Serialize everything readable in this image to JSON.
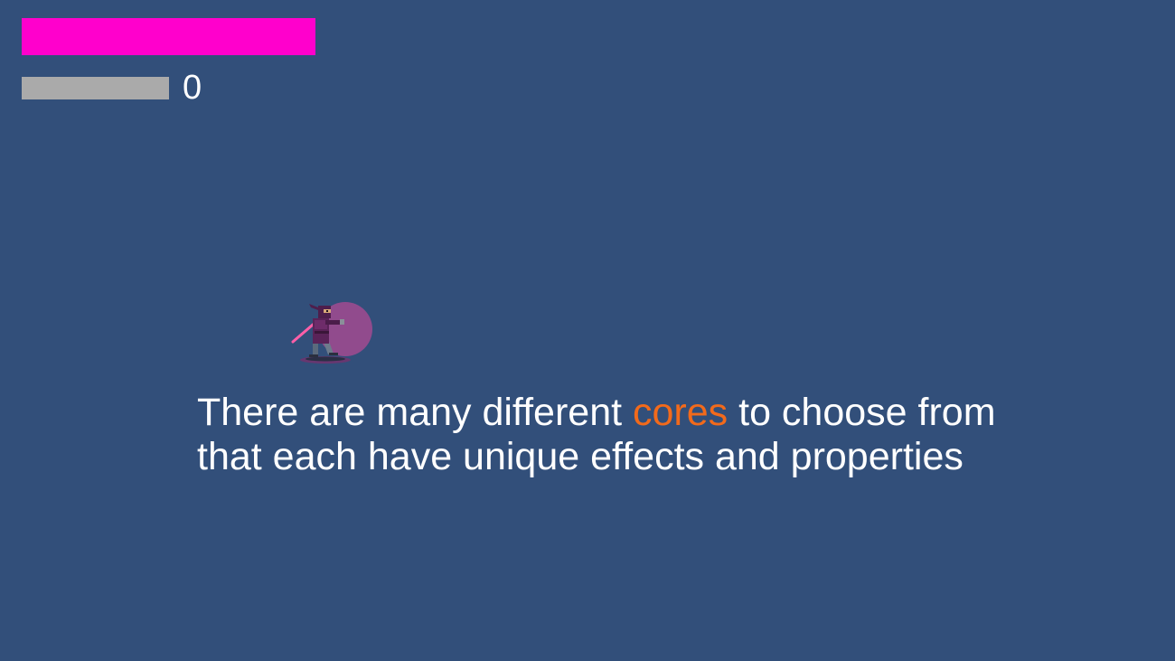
{
  "hud": {
    "health_bar": {
      "fill_fraction": 1.0,
      "color": "#ff00cc"
    },
    "xp_bar": {
      "fill_fraction": 1.0,
      "color": "#aaaaaa"
    },
    "counter": "0"
  },
  "player": {
    "sprite": "ninja-icon",
    "aura_color": "#9b4a8f",
    "weapon_color": "#ff5fa8"
  },
  "tutorial": {
    "line1_before": "There are many different ",
    "line1_highlight": "cores",
    "line1_after": " to choose from",
    "line2": "that each have unique effects and properties",
    "highlight_color": "#f26a1b"
  },
  "colors": {
    "background": "#324f7a",
    "text": "#ffffff"
  }
}
